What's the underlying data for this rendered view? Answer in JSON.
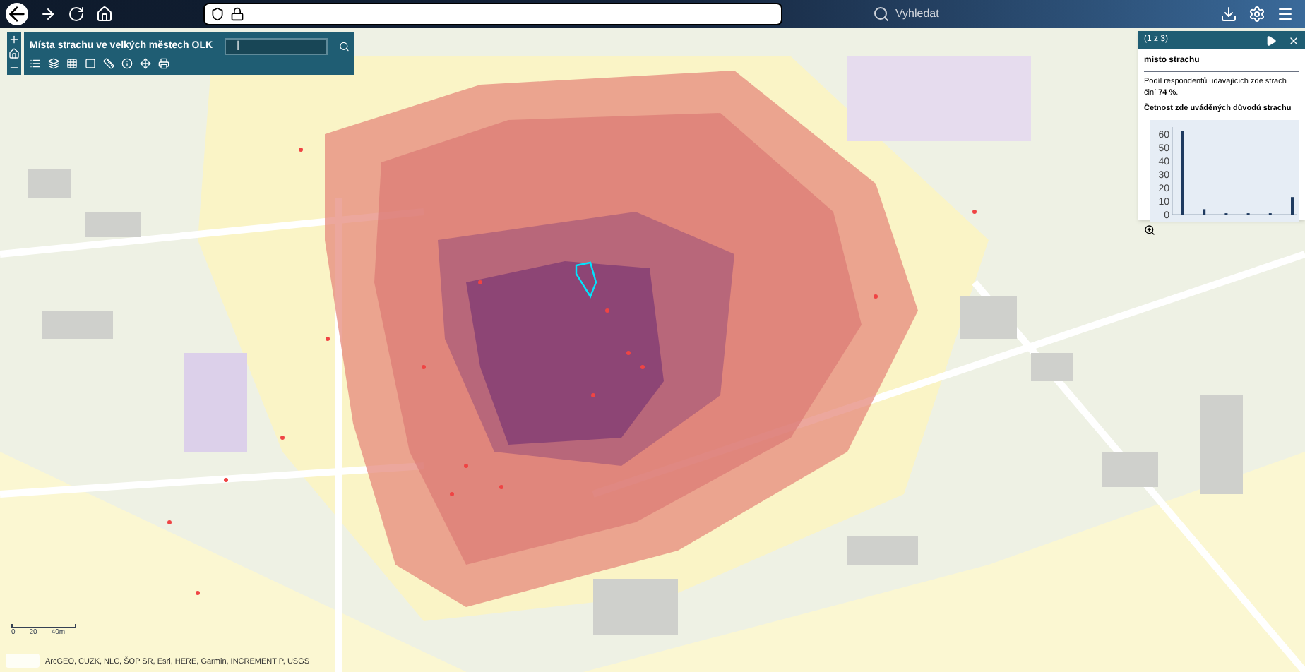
{
  "browser": {
    "search_placeholder": "Vyhledat"
  },
  "app_panel": {
    "title": "Místa strachu ve velkých městech OLK",
    "search_value": "|"
  },
  "popup": {
    "counter": "(1 z 3)",
    "heading": "místo strachu",
    "text": "Podíl respondentů udávajících zde strach činí **74 %**.",
    "chart_title": "Četnost zde uváděných důvodů strachu",
    "chart_data": {
      "type": "bar",
      "categories": [
        null,
        null,
        null,
        null,
        null,
        null
      ],
      "values": [
        62,
        4,
        1,
        1,
        1,
        13
      ],
      "yticks": [
        0,
        10,
        20,
        30,
        40,
        50,
        60
      ],
      "ylim": [
        0,
        65
      ]
    }
  },
  "scale_bar": {
    "labels": [
      "0",
      "20",
      "40m"
    ]
  },
  "attribution": "ArcGEO, CUZK, NLC, ŠOP SR, Esri, HERE, Garmin, INCREMENT P, USGS"
}
